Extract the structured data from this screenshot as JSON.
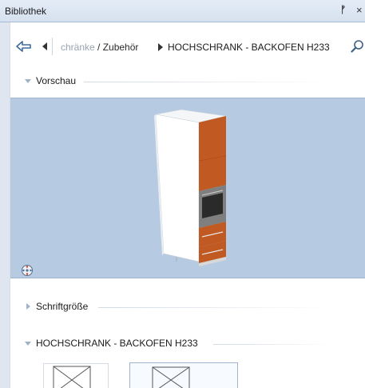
{
  "window": {
    "title": "Bibliothek",
    "pin_glyph": "ᚠ",
    "close_glyph": "×"
  },
  "breadcrumb": {
    "back_icon": "back-arrow-icon",
    "prev_icon": "triangle-left-icon",
    "parent_faded": "chränke",
    "parent_rest": " / Zubehör",
    "current": "HOCHSCHRANK - BACKOFEN H233",
    "search_icon": "search-icon"
  },
  "groups": {
    "preview_label": "Vorschau",
    "font_size_label": "Schriftgröße",
    "item_label": "HOCHSCHRANK - BACKOFEN H233"
  },
  "colors": {
    "preview_background": "#b6cae2",
    "cabinet_front": "#c15a22",
    "cabinet_side": "#ffffff"
  }
}
